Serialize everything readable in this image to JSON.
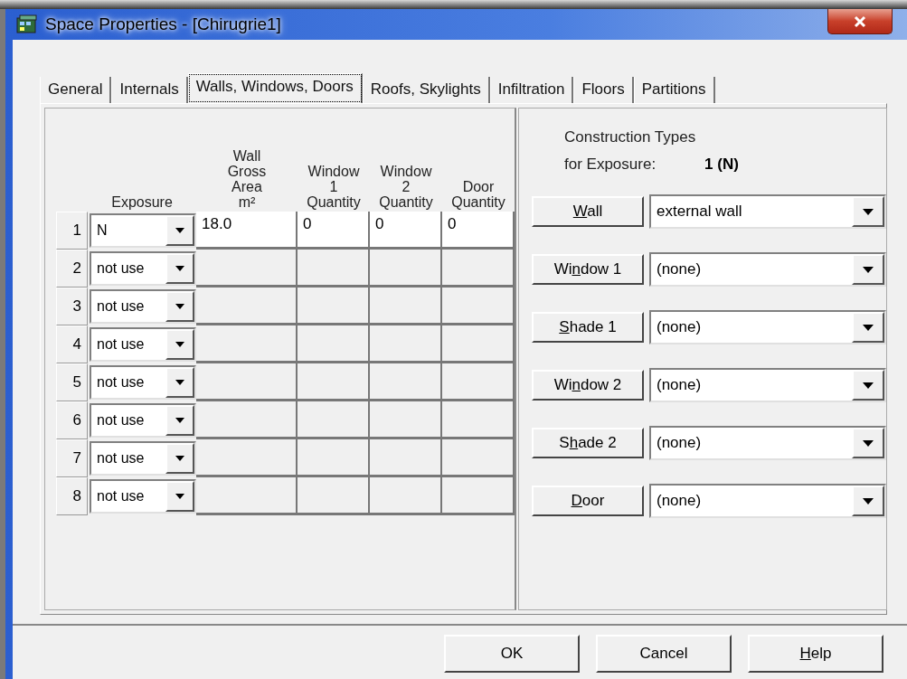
{
  "window": {
    "title": "Space Properties - [Chirugrie1]"
  },
  "tabs": [
    {
      "label": "General",
      "selected": false
    },
    {
      "label": "Internals",
      "selected": false
    },
    {
      "label": "Walls, Windows, Doors",
      "selected": true
    },
    {
      "label": "Roofs, Skylights",
      "selected": false
    },
    {
      "label": "Infiltration",
      "selected": false
    },
    {
      "label": "Floors",
      "selected": false
    },
    {
      "label": "Partitions",
      "selected": false
    }
  ],
  "exposure_table": {
    "columns": [
      "Exposure",
      "Wall\nGross\nArea\nm²",
      "Window\n1\nQuantity",
      "Window\n2\nQuantity",
      "Door\nQuantity"
    ],
    "rows": [
      {
        "number": "1",
        "exposure": "N",
        "enabled": true,
        "cells": [
          "18.0",
          "0",
          "0",
          "0"
        ]
      },
      {
        "number": "2",
        "exposure": "not use",
        "enabled": false
      },
      {
        "number": "3",
        "exposure": "not use",
        "enabled": false
      },
      {
        "number": "4",
        "exposure": "not use",
        "enabled": false
      },
      {
        "number": "5",
        "exposure": "not use",
        "enabled": false
      },
      {
        "number": "6",
        "exposure": "not use",
        "enabled": false
      },
      {
        "number": "7",
        "exposure": "not use",
        "enabled": false
      },
      {
        "number": "8",
        "exposure": "not use",
        "enabled": false
      }
    ]
  },
  "construction_types": {
    "heading": "Construction Types",
    "exposure_label": "for Exposure:",
    "exposure_value": "1 (N)",
    "rows": [
      {
        "button": {
          "key": "W",
          "post": "all"
        },
        "value": "external wall"
      },
      {
        "button": {
          "pre": "Wi",
          "key": "n",
          "post": "dow 1"
        },
        "value": "(none)"
      },
      {
        "button": {
          "key": "S",
          "post": "hade 1"
        },
        "value": "(none)"
      },
      {
        "button": {
          "pre": "Wi",
          "key": "n",
          "post": "dow 2"
        },
        "value": "(none)"
      },
      {
        "button": {
          "pre": "S",
          "key": "h",
          "post": "ade 2"
        },
        "value": "(none)"
      },
      {
        "button": {
          "key": "D",
          "post": "oor"
        },
        "value": "(none)"
      }
    ]
  },
  "buttons": [
    {
      "pre": "OK"
    },
    {
      "pre": "Cancel"
    },
    {
      "key": "H",
      "post": "elp"
    }
  ]
}
